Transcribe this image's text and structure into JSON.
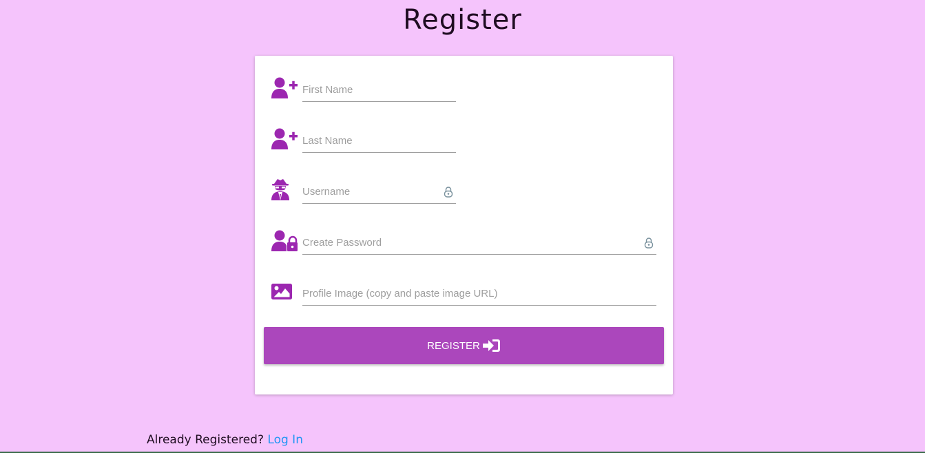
{
  "page": {
    "title": "Register"
  },
  "form": {
    "first_name": {
      "placeholder": "First Name",
      "value": ""
    },
    "last_name": {
      "placeholder": "Last Name",
      "value": ""
    },
    "username": {
      "placeholder": "Username",
      "value": ""
    },
    "password": {
      "placeholder": "Create Password",
      "value": ""
    },
    "profile_image": {
      "placeholder": "Profile Image (copy and paste image URL)",
      "value": ""
    },
    "submit_label": "REGISTER"
  },
  "footer": {
    "prompt": "Already Registered?",
    "login_link": "Log In"
  },
  "colors": {
    "background": "#f5c4fc",
    "accent": "#ab47bc",
    "icon": "#9c27b0",
    "link": "#2196f3"
  },
  "icons": {
    "first_name": "user-plus-icon",
    "last_name": "user-plus-icon",
    "username": "user-secret-icon",
    "password": "user-lock-icon",
    "profile_image": "image-icon",
    "field_lock": "lock-icon",
    "submit": "sign-in-icon"
  }
}
